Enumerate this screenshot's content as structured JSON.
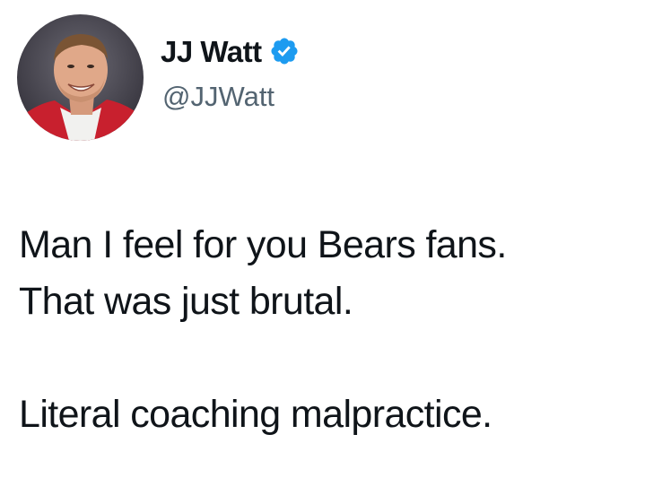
{
  "author": {
    "display_name": "JJ Watt",
    "handle": "@JJWatt",
    "verified": true,
    "verified_icon": "verified-badge-icon"
  },
  "tweet": {
    "lines": [
      "Man I feel for you Bears fans.",
      "That was just brutal.",
      "",
      "Literal coaching malpractice."
    ]
  },
  "colors": {
    "text": "#0f1419",
    "handle": "#536471",
    "verified": "#1d9bf0",
    "background": "#ffffff"
  }
}
